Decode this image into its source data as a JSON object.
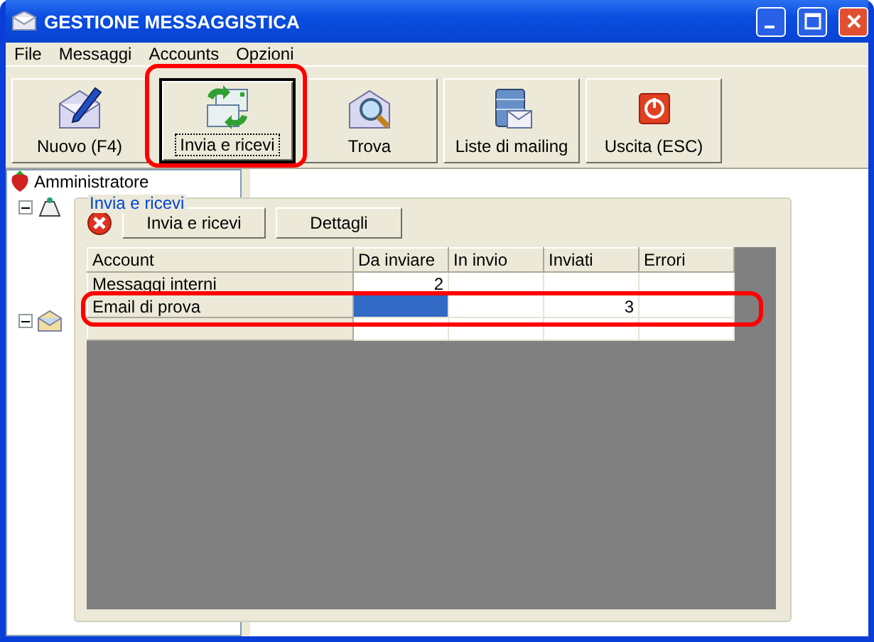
{
  "window": {
    "title": "GESTIONE MESSAGGISTICA"
  },
  "menu": [
    {
      "label": "File"
    },
    {
      "label": "Messaggi"
    },
    {
      "label": "Accounts"
    },
    {
      "label": "Opzioni"
    }
  ],
  "toolbar": [
    {
      "label": "Nuovo (F4)",
      "kind": "new",
      "pressed": false,
      "highlighted": false
    },
    {
      "label": "Invia e ricevi",
      "kind": "sendreceive",
      "pressed": true,
      "highlighted": true
    },
    {
      "label": "Trova",
      "kind": "find",
      "pressed": false,
      "highlighted": false
    },
    {
      "label": "Liste di mailing",
      "kind": "lists",
      "pressed": false,
      "highlighted": false
    },
    {
      "label": "Uscita (ESC)",
      "kind": "exit",
      "pressed": false,
      "highlighted": false
    }
  ],
  "tree": {
    "label": "Amministratore",
    "children": [
      {
        "kind": "bell",
        "expanded": true
      },
      {
        "kind": "mail",
        "expanded": true
      }
    ]
  },
  "panel": {
    "title": "Invia e ricevi",
    "buttons": [
      {
        "label": "Invia e ricevi"
      },
      {
        "label": "Dettagli"
      }
    ],
    "table": {
      "columns": [
        "Account",
        "Da inviare",
        "In invio",
        "Inviati",
        "Errori"
      ],
      "rows": [
        {
          "highlighted": false,
          "cells": [
            {
              "text": "Messaggi interni",
              "selected": false
            },
            {
              "text": "2",
              "selected": false
            },
            {
              "selected": false
            },
            {
              "selected": false
            },
            {
              "selected": false
            }
          ]
        },
        {
          "highlighted": true,
          "cells": [
            {
              "text": "Email di prova",
              "selected": false
            },
            {
              "selected": true
            },
            {
              "selected": false
            },
            {
              "text": "3",
              "selected": false
            },
            {
              "selected": false
            }
          ]
        },
        {
          "highlighted": false,
          "cells": [
            {
              "selected": false
            },
            {
              "selected": false
            },
            {
              "selected": false
            },
            {
              "selected": false
            },
            {
              "selected": false
            }
          ]
        }
      ]
    }
  }
}
